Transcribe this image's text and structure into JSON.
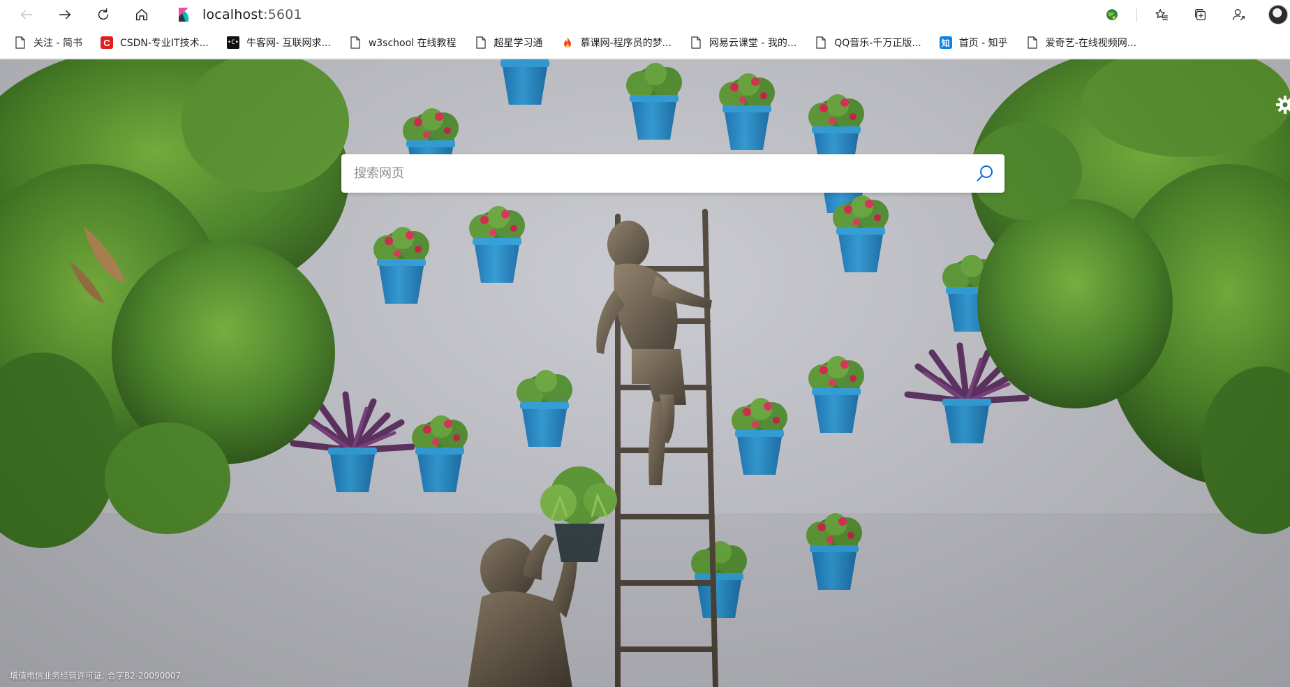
{
  "browser": {
    "url_host": "localhost",
    "url_port": ":5601",
    "bookmarks": [
      {
        "label": "关注 - 简书",
        "icon": "page-icon"
      },
      {
        "label": "CSDN-专业IT技术...",
        "icon": "csdn-icon",
        "icon_text": "C"
      },
      {
        "label": "牛客网- 互联网求...",
        "icon": "nowcoder-icon",
        "icon_text": "•C•"
      },
      {
        "label": "w3school 在线教程",
        "icon": "page-icon"
      },
      {
        "label": "超星学习通",
        "icon": "page-icon"
      },
      {
        "label": "慕课网-程序员的梦...",
        "icon": "imooc-icon"
      },
      {
        "label": "网易云课堂 - 我的...",
        "icon": "page-icon"
      },
      {
        "label": "QQ音乐-千万正版...",
        "icon": "page-icon"
      },
      {
        "label": "首页 - 知乎",
        "icon": "zhihu-icon",
        "icon_text": "知"
      },
      {
        "label": "爱奇艺-在线视频网...",
        "icon": "page-icon"
      }
    ]
  },
  "search": {
    "placeholder": "搜索网页",
    "value": ""
  },
  "footer": {
    "license_text": "增值电信业务经营许可证: 合字B2-20090007"
  },
  "colors": {
    "accent": "#0a6bd6",
    "pot_blue": "#1f8fd0",
    "foliage_green": "#4a8a2a",
    "wall": "#c8c9cf"
  }
}
